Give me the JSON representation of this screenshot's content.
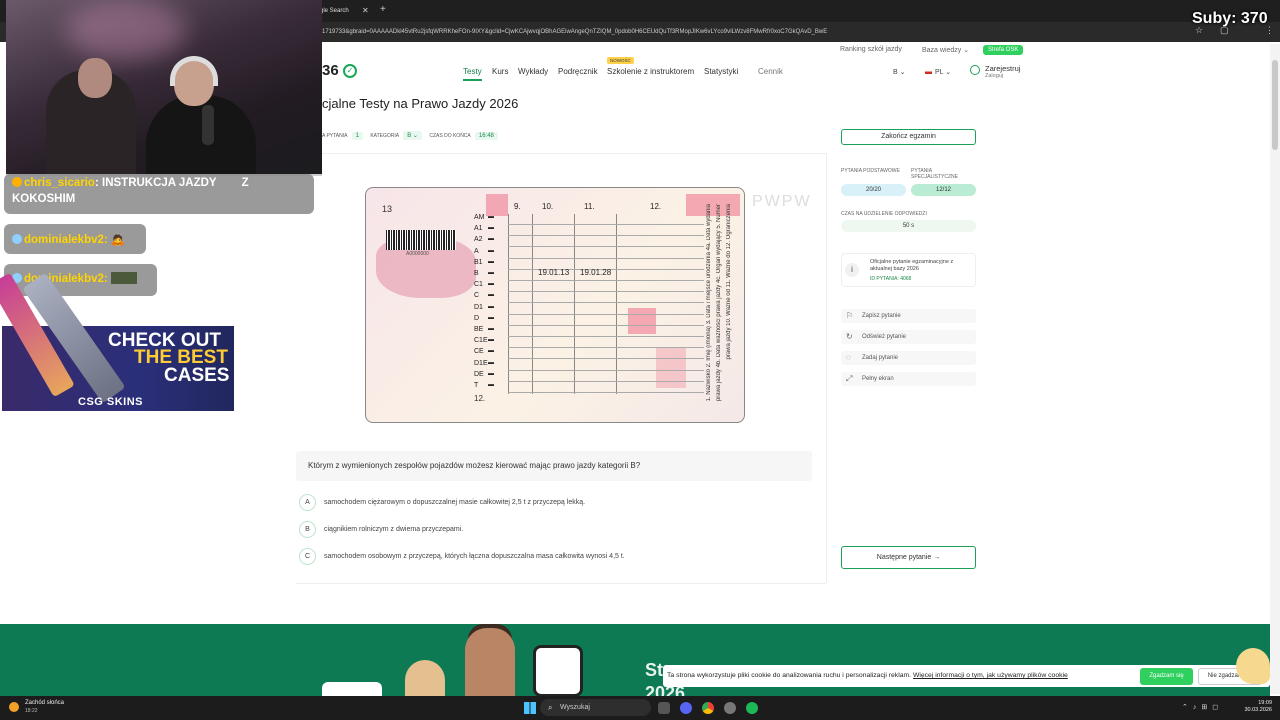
{
  "browser": {
    "tab_label": "gle Search",
    "url": "1719733&gbraid=0AAAAADkl45vtRu2jsfqWRRKheFOn-9IXY&gclid=CjwKCAjwvqjOBhAGEiwAngeQnTZIQM_0pdob0H6CEUdQuTf3RMopJIKw6vLYco9vILWzv8FMwRfr0xoC7GkQAvD_BwE"
  },
  "site": {
    "toplinks": {
      "ranking": "Ranking szkół jazdy",
      "baza": "Baza wiedzy",
      "strefa": "Strefa OSK"
    },
    "logo": "36",
    "nav": [
      "Testy",
      "Kurs",
      "Wykłady",
      "Podręcznik",
      "Szkolenie z instruktorem",
      "Statystyki",
      "Cennik"
    ],
    "nowosc": "NOWOŚĆ",
    "lang_b": "B",
    "lang_pl": "PL",
    "register": "Zarejestruj",
    "login": "Zaloguj"
  },
  "exam": {
    "title": "cjalne Testy na Prawo Jazdy 2026",
    "meta": {
      "question_label": "A PYTANIA",
      "question_num": "1",
      "category_label": "KATEGORIA",
      "category": "B",
      "time_label": "CZAS DO KOŃCA",
      "time": "16:48"
    },
    "end_button": "Zakończ egzamin",
    "question": "Którym z wymienionych zespołów pojazdów możesz kierować mając prawo jazdy kategorii B?",
    "answers": [
      {
        "letter": "A",
        "text": "samochodem ciężarowym o dopuszczalnej masie całkowitej 2,5 t z przyczepą lekką."
      },
      {
        "letter": "B",
        "text": "ciągnikiem rolniczym z dwiema przyczepami."
      },
      {
        "letter": "C",
        "text": "samochodem osobowym z przyczepą, których łączna dopuszczalna masa całkowita wynosi 4,5 t."
      }
    ],
    "next_button": "Następne pytanie"
  },
  "licence": {
    "field13": "13",
    "field12": "12.",
    "barcode_num": "A0000000",
    "col9": "9.",
    "col10": "10.",
    "col11": "11.",
    "col12": "12.",
    "categories": [
      "AM",
      "A1",
      "A2",
      "A",
      "B1",
      "B",
      "C1",
      "C",
      "D1",
      "D",
      "BE",
      "C1E",
      "CE",
      "D1E",
      "DE",
      "T"
    ],
    "date10": "19.01.13",
    "date11": "19.01.28",
    "watermark": "PWPW",
    "side1": "1. Nazwisko 2. Imię (imiona) 3. Data i miejsce urodzenia 4a. Data wydania",
    "side2": "prawa jazdy 4b. Data ważności prawa jazdy 4c. Organ wydający 5. Numer",
    "side3": "prawa jazdy 10. Ważne od 11. Ważne do 12. Ograniczenia"
  },
  "panel": {
    "basic_label": "PYTANIA PODSTAWOWE",
    "basic_value": "20/20",
    "spec_label": "PYTANIA SPECJALISTYCZNE",
    "spec_value": "12/12",
    "time_label": "CZAS NA UDZIELENIE ODPOWIEDZI",
    "time_value": "50 s",
    "info_text": "Oficjalne pytanie egzaminacyjne z aktualnej bazy 2026",
    "info_id": "ID PYTANIA: 4068",
    "actions": [
      "Zapisz pytanie",
      "Odśwież pytanie",
      "Zadaj pytanie",
      "Pełny ekran"
    ]
  },
  "banner": {
    "headline1": "St",
    "headline2": "2026"
  },
  "cookie": {
    "text": "Ta strona wykorzystuje pliki cookie do analizowania ruchu i personalizacji reklam.",
    "link": "Więcej informacji o tym, jak używamy plików cookie",
    "accept": "Zgadzam się",
    "reject": "Nie zgadzam się"
  },
  "taskbar": {
    "weather_title": "Zachód słońca",
    "weather_time": "18:22",
    "search": "Wyszukaj",
    "time": "19:09",
    "date": "30.03.2026"
  },
  "stream": {
    "subs": "Suby: 370",
    "chat": [
      {
        "user": "chris_sicario",
        "text": ": INSTRUKCJA JAZDY",
        "text2": "Z",
        "text3": "KOKOSHIM"
      },
      {
        "user": "dominialekbv2:",
        "text": ""
      },
      {
        "user": "dominialekbv2:",
        "text": ""
      }
    ],
    "ad_line1": "CHECK OUT",
    "ad_line2": "THE BEST",
    "ad_line3": "CASES",
    "ad_brand": "CSG SKINS"
  }
}
